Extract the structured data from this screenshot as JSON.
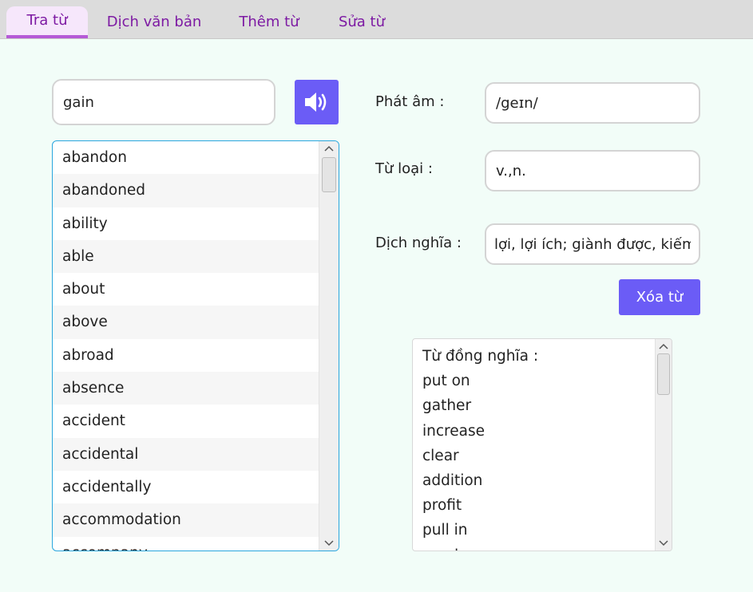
{
  "tabs": [
    {
      "label": "Tra từ",
      "active": true
    },
    {
      "label": "Dịch văn bản",
      "active": false
    },
    {
      "label": "Thêm từ",
      "active": false
    },
    {
      "label": "Sửa từ",
      "active": false
    }
  ],
  "search": {
    "value": "gain"
  },
  "speaker_icon": "speaker-volume-icon",
  "word_list": {
    "items": [
      "abandon",
      "abandoned",
      "ability",
      "able",
      "about",
      "above",
      "abroad",
      "absence",
      "accident",
      "accidental",
      "accidentally",
      "accommodation",
      "accompany"
    ]
  },
  "details": {
    "pronunciation_label": "Phát âm :",
    "pronunciation_value": "/geɪn/",
    "word_type_label": "Từ loại :",
    "word_type_value": "v.,n.",
    "meaning_label": "Dịch nghĩa :",
    "meaning_value": "lợi, lợi ích; giành được, kiếm"
  },
  "delete_button": "Xóa từ",
  "synonyms": {
    "lines": [
      "Từ đồng nghĩa :",
      "put on",
      "gather",
      "increase",
      "clear",
      "addition",
      "profit",
      "pull in",
      "reach"
    ]
  },
  "colors": {
    "accent": "#6b5cf6",
    "tab_text": "#7d1aa3",
    "background": "#f2fdf8",
    "list_border": "#2aa6de"
  }
}
